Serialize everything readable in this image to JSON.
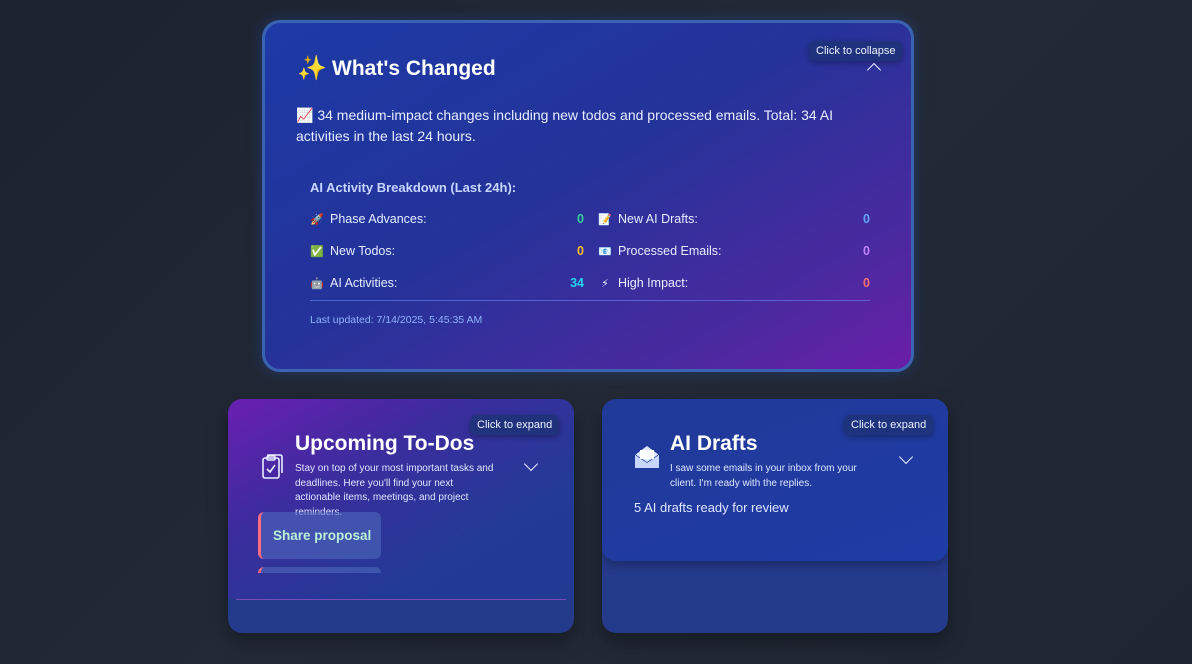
{
  "whats_changed": {
    "icon": "sparkles-icon",
    "title": "What's Changed",
    "collapse_tip": "Click to collapse",
    "summary": "📈 34 medium-impact changes including new todos and processed emails. Total: 34 AI activities in the last 24 hours.",
    "breakdown_title": "AI Activity Breakdown (Last 24h):",
    "stats": [
      {
        "icon": "🚀",
        "icon_name": "rocket-icon",
        "label": "Phase Advances:",
        "value": "0",
        "color": "#34d399"
      },
      {
        "icon": "📝",
        "icon_name": "memo-icon",
        "label": "New AI Drafts:",
        "value": "0",
        "color": "#60a5fa"
      },
      {
        "icon": "✅",
        "icon_name": "check-icon",
        "label": "New Todos:",
        "value": "0",
        "color": "#fbbf24"
      },
      {
        "icon": "📧",
        "icon_name": "email-icon",
        "label": "Processed Emails:",
        "value": "0",
        "color": "#c084fc"
      },
      {
        "icon": "🤖",
        "icon_name": "robot-icon",
        "label": "AI Activities:",
        "value": "34",
        "color": "#22d3ee"
      },
      {
        "icon": "⚡",
        "icon_name": "lightning-icon",
        "label": "High Impact:",
        "value": "0",
        "color": "#f87171"
      }
    ],
    "updated": "Last updated: 7/14/2025, 5:45:35 AM"
  },
  "todos": {
    "icon": "clipboard-check-icon",
    "title": "Upcoming To-Dos",
    "description": "Stay on top of your most important tasks and deadlines. Here you'll find your next actionable items, meetings, and project reminders.",
    "expand_tip": "Click to expand",
    "items": [
      "Share proposal"
    ]
  },
  "drafts": {
    "icon": "envelope-open-icon",
    "title": "AI Drafts",
    "description": "I saw some emails in your inbox from your client. I'm ready with the replies.",
    "expand_tip": "Click to expand",
    "status": "5 AI drafts ready for review"
  }
}
